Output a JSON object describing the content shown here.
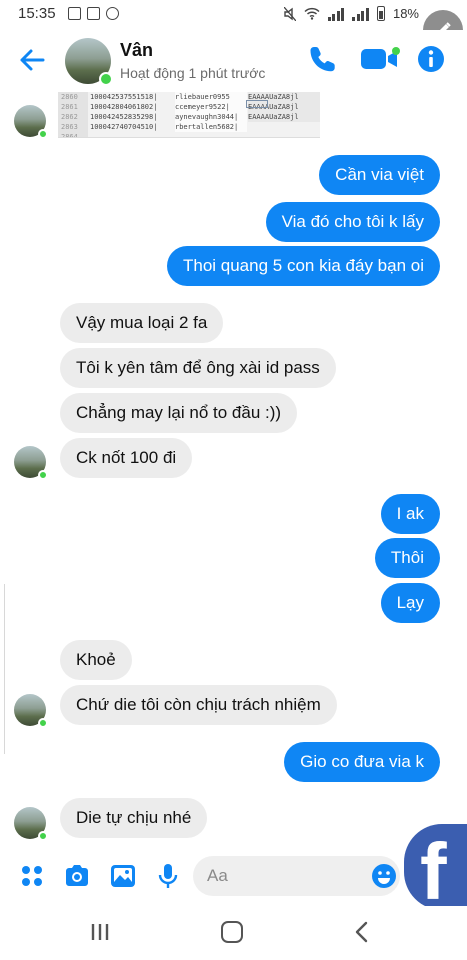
{
  "status_bar": {
    "time": "15:35",
    "battery_percent": "18%",
    "icons": [
      "image-icon",
      "image-icon",
      "messenger-icon",
      "mute-icon",
      "wifi-icon",
      "signal-icon",
      "signal-icon",
      "battery-icon"
    ]
  },
  "header": {
    "contact_name": "Vân",
    "presence": "Hoạt động 1 phút trước",
    "online": true,
    "icons": [
      "back-arrow-icon",
      "phone-icon",
      "video-camera-icon",
      "info-icon"
    ],
    "accent_color": "#0f86f4"
  },
  "shared_image": {
    "rows": [
      {
        "line": "2860",
        "id": "100042537551518|",
        "user": "rliebauer0955",
        "token": ""
      },
      {
        "line": "2861",
        "id": "100042804061802|",
        "user": "ccemeyer9522|",
        "token": "EAAAAUaZA8jl"
      },
      {
        "line": "2862",
        "id": "100042452835298|",
        "user": "aynevaughn3044|",
        "token": "EAAAAUaZA8jl"
      },
      {
        "line": "2863",
        "id": "100042740704510|",
        "user": "rbertallen5682|",
        "token": "EAAAAUaZA8jl"
      },
      {
        "line": "2864",
        "id": "",
        "user": "",
        "token": ""
      }
    ]
  },
  "messages": [
    {
      "dir": "out",
      "text": "Cần via việt"
    },
    {
      "dir": "out",
      "text": "Via đó cho tôi k lấy"
    },
    {
      "dir": "out",
      "text": "Thoi quang 5 con kia đáy bạn oi"
    },
    {
      "dir": "in",
      "text": "Vậy mua loại 2 fa"
    },
    {
      "dir": "in",
      "text": "Tôi k yên tâm để ông xài id pass"
    },
    {
      "dir": "in",
      "text": "Chẳng may lại nổ to đầu :))"
    },
    {
      "dir": "in",
      "text": "Ck nốt 100 đi"
    },
    {
      "dir": "out",
      "text": "I ak"
    },
    {
      "dir": "out",
      "text": "Thôi"
    },
    {
      "dir": "out",
      "text": "Lạy"
    },
    {
      "dir": "in",
      "text": "Khoẻ"
    },
    {
      "dir": "in",
      "text": "Chứ die tôi còn chịu trách nhiệm"
    },
    {
      "dir": "out",
      "text": "Gio co đưa via k"
    },
    {
      "dir": "in",
      "text": "Die tự chịu nhé"
    }
  ],
  "composer": {
    "placeholder": "Aa",
    "icons": [
      "menu-dots-icon",
      "camera-icon",
      "gallery-icon",
      "microphone-icon",
      "emoji-icon"
    ]
  },
  "overlay": {
    "brand": "f",
    "brand_color": "#3b5eb0"
  },
  "navigation": {
    "icons": [
      "recents-icon",
      "home-icon",
      "back-icon"
    ]
  }
}
